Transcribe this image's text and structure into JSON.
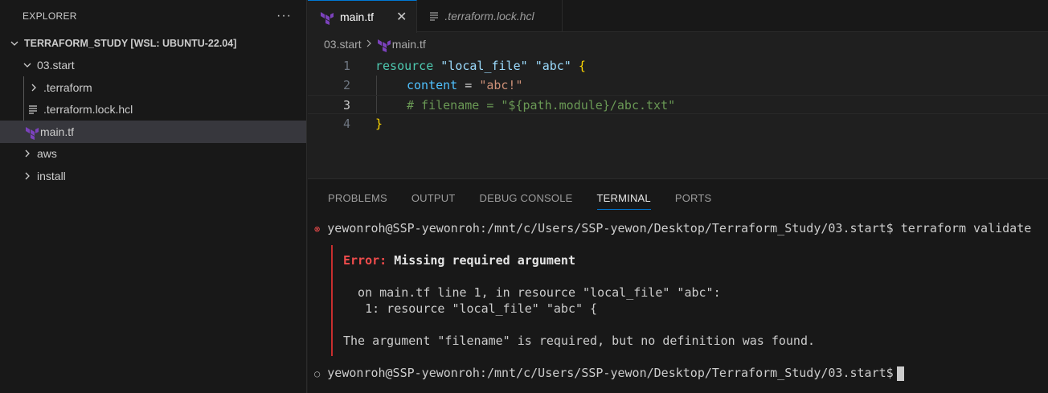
{
  "sidebar": {
    "title": "EXPLORER",
    "more": "···",
    "root_label": "TERRAFORM_STUDY [WSL: UBUNTU-22.04]",
    "items": [
      {
        "label": "03.start"
      },
      {
        "label": ".terraform"
      },
      {
        "label": ".terraform.lock.hcl"
      },
      {
        "label": "main.tf"
      },
      {
        "label": "aws"
      },
      {
        "label": "install"
      }
    ]
  },
  "editor": {
    "tabs": [
      {
        "label": "main.tf",
        "close": "✕"
      },
      {
        "label": ".terraform.lock.hcl"
      }
    ],
    "breadcrumb": {
      "folder": "03.start",
      "file": "main.tf"
    },
    "lines": [
      {
        "num": "1",
        "parts": [
          "resource",
          " ",
          "\"local_file\"",
          " ",
          "\"abc\"",
          " ",
          "{"
        ]
      },
      {
        "num": "2",
        "parts": [
          "content",
          " = ",
          "\"abc!\""
        ]
      },
      {
        "num": "3",
        "parts": [
          "# filename = \"${path.module}/abc.txt\""
        ]
      },
      {
        "num": "4",
        "parts": [
          "}"
        ]
      }
    ]
  },
  "panel": {
    "tabs": [
      "PROBLEMS",
      "OUTPUT",
      "DEBUG CONSOLE",
      "TERMINAL",
      "PORTS"
    ],
    "terminal": {
      "error_icon": "⊗",
      "prompt_icon": "○",
      "cmd1": "yewonroh@SSP-yewonroh:/mnt/c/Users/SSP-yewon/Desktop/Terraform_Study/03.start$ terraform validate",
      "error_label": "Error:",
      "error_title": "Missing required argument",
      "on_line": "  on main.tf line 1, in resource \"local_file\" \"abc\":",
      "src_line": "   1: resource \"local_file\" \"abc\" {",
      "message": "The argument \"filename\" is required, but no definition was found.",
      "prompt2": "yewonroh@SSP-yewonroh:/mnt/c/Users/SSP-yewon/Desktop/Terraform_Study/03.start$"
    }
  },
  "colors": {
    "terraform_icon": "#7b42bc",
    "accent": "#0078d4",
    "error": "#f14c4c"
  }
}
